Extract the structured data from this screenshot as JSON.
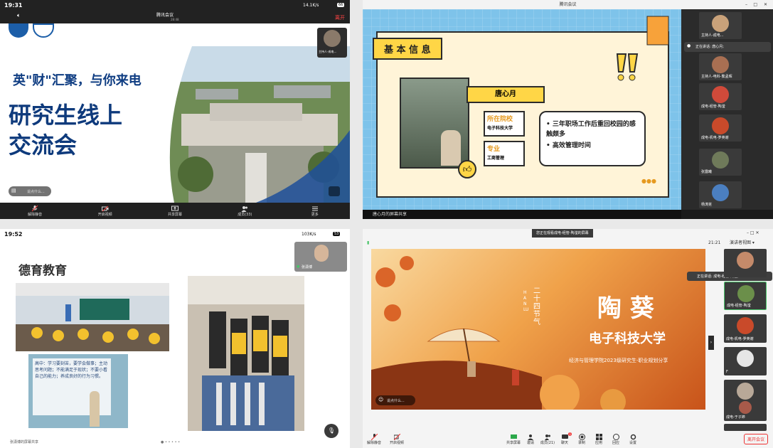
{
  "q1": {
    "status": {
      "time": "19:31",
      "center": "腾讯会议",
      "center_sub": "28:48",
      "speed": "14.1K/s",
      "battery": "66",
      "leave": "离开"
    },
    "slide": {
      "headline": "英\"财\"汇聚，与你来电",
      "title_line1": "研究生线上",
      "title_line2": "交流会"
    },
    "presenter": {
      "name": "主持人-成电..."
    },
    "chat_placeholder": "说点什么...",
    "toolbar": [
      {
        "label": "解除静音",
        "icon": "mic-icon"
      },
      {
        "label": "开启视频",
        "icon": "camera-icon"
      },
      {
        "label": "共享屏幕",
        "icon": "share-screen-icon"
      },
      {
        "label": "成员(33)",
        "icon": "members-icon"
      },
      {
        "label": "更多",
        "icon": "more-icon"
      }
    ]
  },
  "q2": {
    "window_title": "腾讯会议",
    "slide": {
      "header": "基 本 信 息",
      "name": "唐心月",
      "college_label": "所在院校",
      "college": "电子科技大学",
      "major_label": "专业",
      "major": "工商管理",
      "bullet1": "三年职场工作后重回校园的感触颇多",
      "bullet2": "高效管理时间"
    },
    "speaking": "正在讲话: 唐心月;",
    "participants": [
      "主持人-成电...",
      "主持人-电科-繁孟晖",
      "成电-经管-陶滢",
      "成电-机电-罗英谢",
      "张露曦",
      "杨涛芜"
    ],
    "footer": "唐心月的屏幕共享"
  },
  "q3": {
    "status": {
      "time": "19:52",
      "speed": "103K/s",
      "battery": "53"
    },
    "slide": {
      "title": "德育教育",
      "board_text": "高中：学习要刻苦，要学会做事；主动思考问题；不能满足于现状；不要小看自己的能力；养成良好的行为习惯。"
    },
    "self_view": {
      "name": "张潇博"
    },
    "footer": "张潇博的屏幕共享"
  },
  "q4": {
    "notice": "您正在观看成电-经管-陶滢的屏幕",
    "clock": "21:21",
    "view_mode": "演讲者视图",
    "speaking": "正在讲话: 成电-经管-陶滢;",
    "slide": {
      "vertical_cn": "二十四节气",
      "vertical_pin": "HAN LU",
      "name": "陶 葵",
      "school": "电子科技大学",
      "subtitle": "经济与管理学院2023级研究生-职业规划分享"
    },
    "chat_placeholder": "说点什么...",
    "participants": [
      "",
      "成电-经管-陶滢",
      "成电-机电-罗英谢",
      "F",
      "",
      "成电-于子婷",
      ""
    ],
    "toolbar": [
      {
        "label": "解除静音"
      },
      {
        "label": "开启视频"
      },
      {
        "label": "共享屏幕"
      },
      {
        "label": "邀请"
      },
      {
        "label": "成员(21)"
      },
      {
        "label": "聊天"
      },
      {
        "label": "录制"
      },
      {
        "label": "应用"
      },
      {
        "label": "回应"
      },
      {
        "label": "设置"
      }
    ],
    "chat_badge": "1",
    "leave": "离开会议"
  }
}
